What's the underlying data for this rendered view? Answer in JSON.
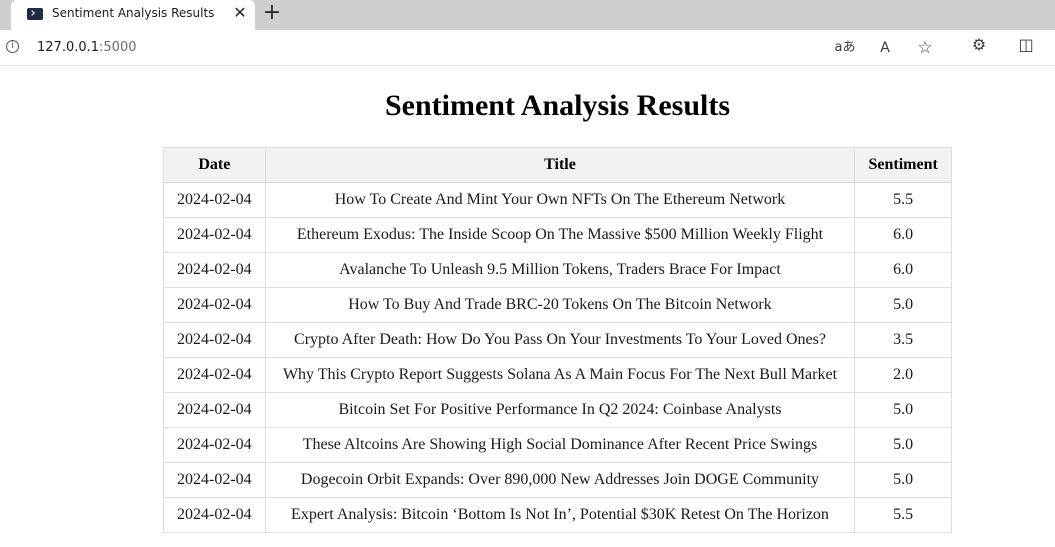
{
  "browser": {
    "tab": {
      "title": "Sentiment Analysis Results",
      "favicon": "terminal-icon",
      "close_glyph": "✕"
    },
    "new_tab_glyph": "+",
    "address": {
      "host": "127.0.0.1",
      "port": ":5000"
    },
    "toolbar_icons": {
      "translate": "aあ",
      "read_aloud": "A",
      "favorite": "☆",
      "extensions": "⚙",
      "split_screen": "◫"
    }
  },
  "page": {
    "title": "Sentiment Analysis Results",
    "table": {
      "columns": [
        "Date",
        "Title",
        "Sentiment"
      ],
      "rows": [
        {
          "date": "2024-02-04",
          "title": "How To Create And Mint Your Own NFTs On The Ethereum Network",
          "sentiment": "5.5"
        },
        {
          "date": "2024-02-04",
          "title": "Ethereum Exodus: The Inside Scoop On The Massive $500 Million Weekly Flight",
          "sentiment": "6.0"
        },
        {
          "date": "2024-02-04",
          "title": "Avalanche To Unleash 9.5 Million Tokens, Traders Brace For Impact",
          "sentiment": "6.0"
        },
        {
          "date": "2024-02-04",
          "title": "How To Buy And Trade BRC-20 Tokens On The Bitcoin Network",
          "sentiment": "5.0"
        },
        {
          "date": "2024-02-04",
          "title": "Crypto After Death: How Do You Pass On Your Investments To Your Loved Ones?",
          "sentiment": "3.5"
        },
        {
          "date": "2024-02-04",
          "title": "Why This Crypto Report Suggests Solana As A Main Focus For The Next Bull Market",
          "sentiment": "2.0"
        },
        {
          "date": "2024-02-04",
          "title": "Bitcoin Set For Positive Performance In Q2 2024: Coinbase Analysts",
          "sentiment": "5.0"
        },
        {
          "date": "2024-02-04",
          "title": "These Altcoins Are Showing High Social Dominance After Recent Price Swings",
          "sentiment": "5.0"
        },
        {
          "date": "2024-02-04",
          "title": "Dogecoin Orbit Expands: Over 890,000 New Addresses Join DOGE Community",
          "sentiment": "5.0"
        },
        {
          "date": "2024-02-04",
          "title": "Expert Analysis: Bitcoin ‘Bottom Is Not In’, Potential $30K Retest On The Horizon",
          "sentiment": "5.5"
        }
      ]
    }
  }
}
